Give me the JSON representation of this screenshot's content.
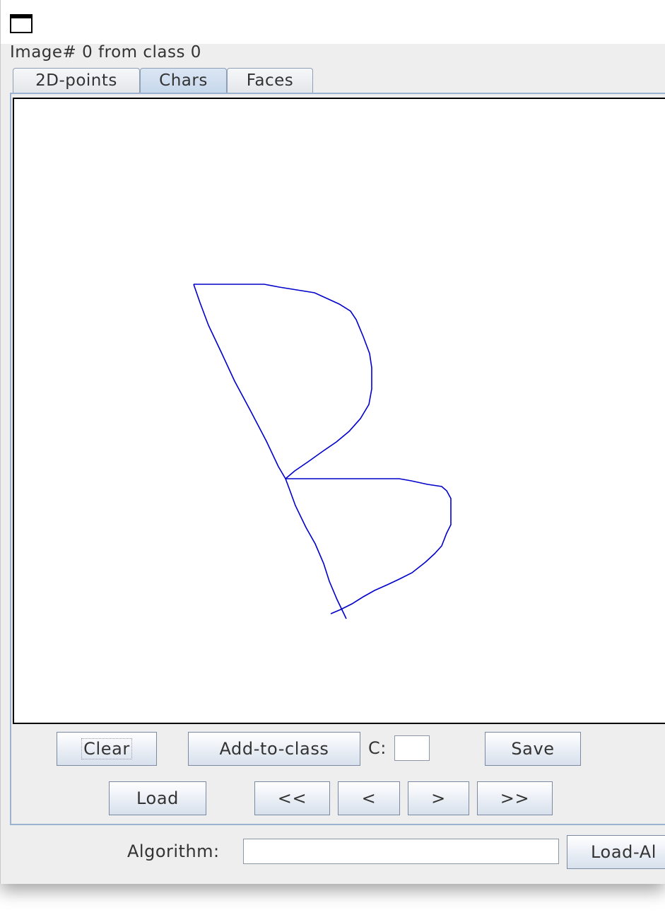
{
  "window": {
    "status_text": "Image# 0 from class 0"
  },
  "tabs": [
    {
      "label": "2D-points",
      "selected": false
    },
    {
      "label": "Chars",
      "selected": true
    },
    {
      "label": "Faces",
      "selected": false
    }
  ],
  "canvas": {
    "stroke_color": "#0000cc",
    "drawn_character": "B"
  },
  "controls": {
    "clear_label": "Clear",
    "add_to_class_label": "Add-to-class",
    "class_label": "C:",
    "class_value": "",
    "save_label": "Save",
    "load_label": "Load",
    "first_label": "<<",
    "prev_label": "<",
    "next_label": ">",
    "last_label": ">>"
  },
  "footer": {
    "algorithm_label": "Algorithm:",
    "algorithm_value": "",
    "load_algorithm_label": "Load-Al"
  },
  "colors": {
    "tab_selected": "#c7d8ec",
    "panel_border": "#9bb3d0",
    "stroke": "#0000cc"
  }
}
